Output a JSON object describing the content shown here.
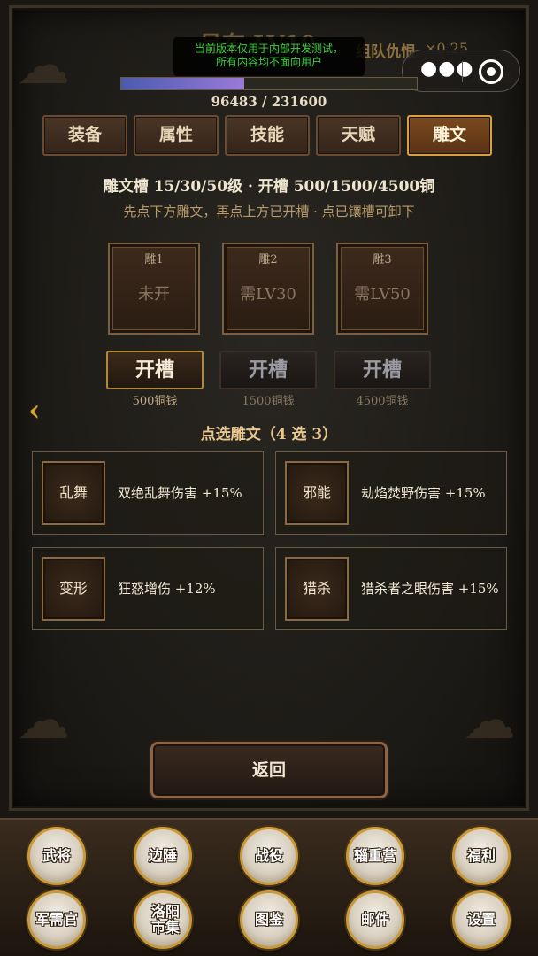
{
  "header": {
    "hero_title": "吕布 LV19",
    "team_label": "组队仇恨",
    "team_multiplier": "×0.25",
    "debug_notice": [
      "当前版本仅用于内部开发测试，",
      "所有内容均不面向用户"
    ]
  },
  "exp": {
    "current": 96483,
    "max": 231600,
    "text": "96483 / 231600"
  },
  "tabs": [
    {
      "label": "装备",
      "active": false
    },
    {
      "label": "属性",
      "active": false
    },
    {
      "label": "技能",
      "active": false
    },
    {
      "label": "天赋",
      "active": false
    },
    {
      "label": "雕文",
      "active": true
    }
  ],
  "glyph": {
    "slot_info": "雕文槽  15/30/50级 · 开槽 500/1500/4500铜",
    "hint": "先点下方雕文，再点上方已开槽 · 点已镶槽可卸下",
    "slots": [
      {
        "name": "雕1",
        "state": "未开",
        "button": "开槽",
        "cost": "500铜钱",
        "enabled": true
      },
      {
        "name": "雕2",
        "state": "需LV30",
        "button": "开槽",
        "cost": "1500铜钱",
        "enabled": false
      },
      {
        "name": "雕3",
        "state": "需LV50",
        "button": "开槽",
        "cost": "4500铜钱",
        "enabled": false
      }
    ],
    "pick_title": "点选雕文（4 选 3）",
    "options": [
      {
        "icon": "乱舞",
        "desc": "双绝乱舞伤害 +15%"
      },
      {
        "icon": "邪能",
        "desc": "劫焰焚野伤害 +15%"
      },
      {
        "icon": "变形",
        "desc": "狂怒增伤 +12%"
      },
      {
        "icon": "猎杀",
        "desc": "猎杀者之眼伤害 +15%"
      }
    ]
  },
  "return_label": "返回",
  "bottom_nav": [
    {
      "label": "武将"
    },
    {
      "label": "边陲"
    },
    {
      "label": "战役"
    },
    {
      "label": "辎重营"
    },
    {
      "label": "福利"
    },
    {
      "label": "军需官"
    },
    {
      "label": "洛阳市集"
    },
    {
      "label": "图鉴"
    },
    {
      "label": "邮件"
    },
    {
      "label": "设置"
    }
  ],
  "colors": {
    "accent_gold": "#d8a040",
    "exp_fill": "#9a7ad8",
    "debug_text": "#3ad13a"
  }
}
